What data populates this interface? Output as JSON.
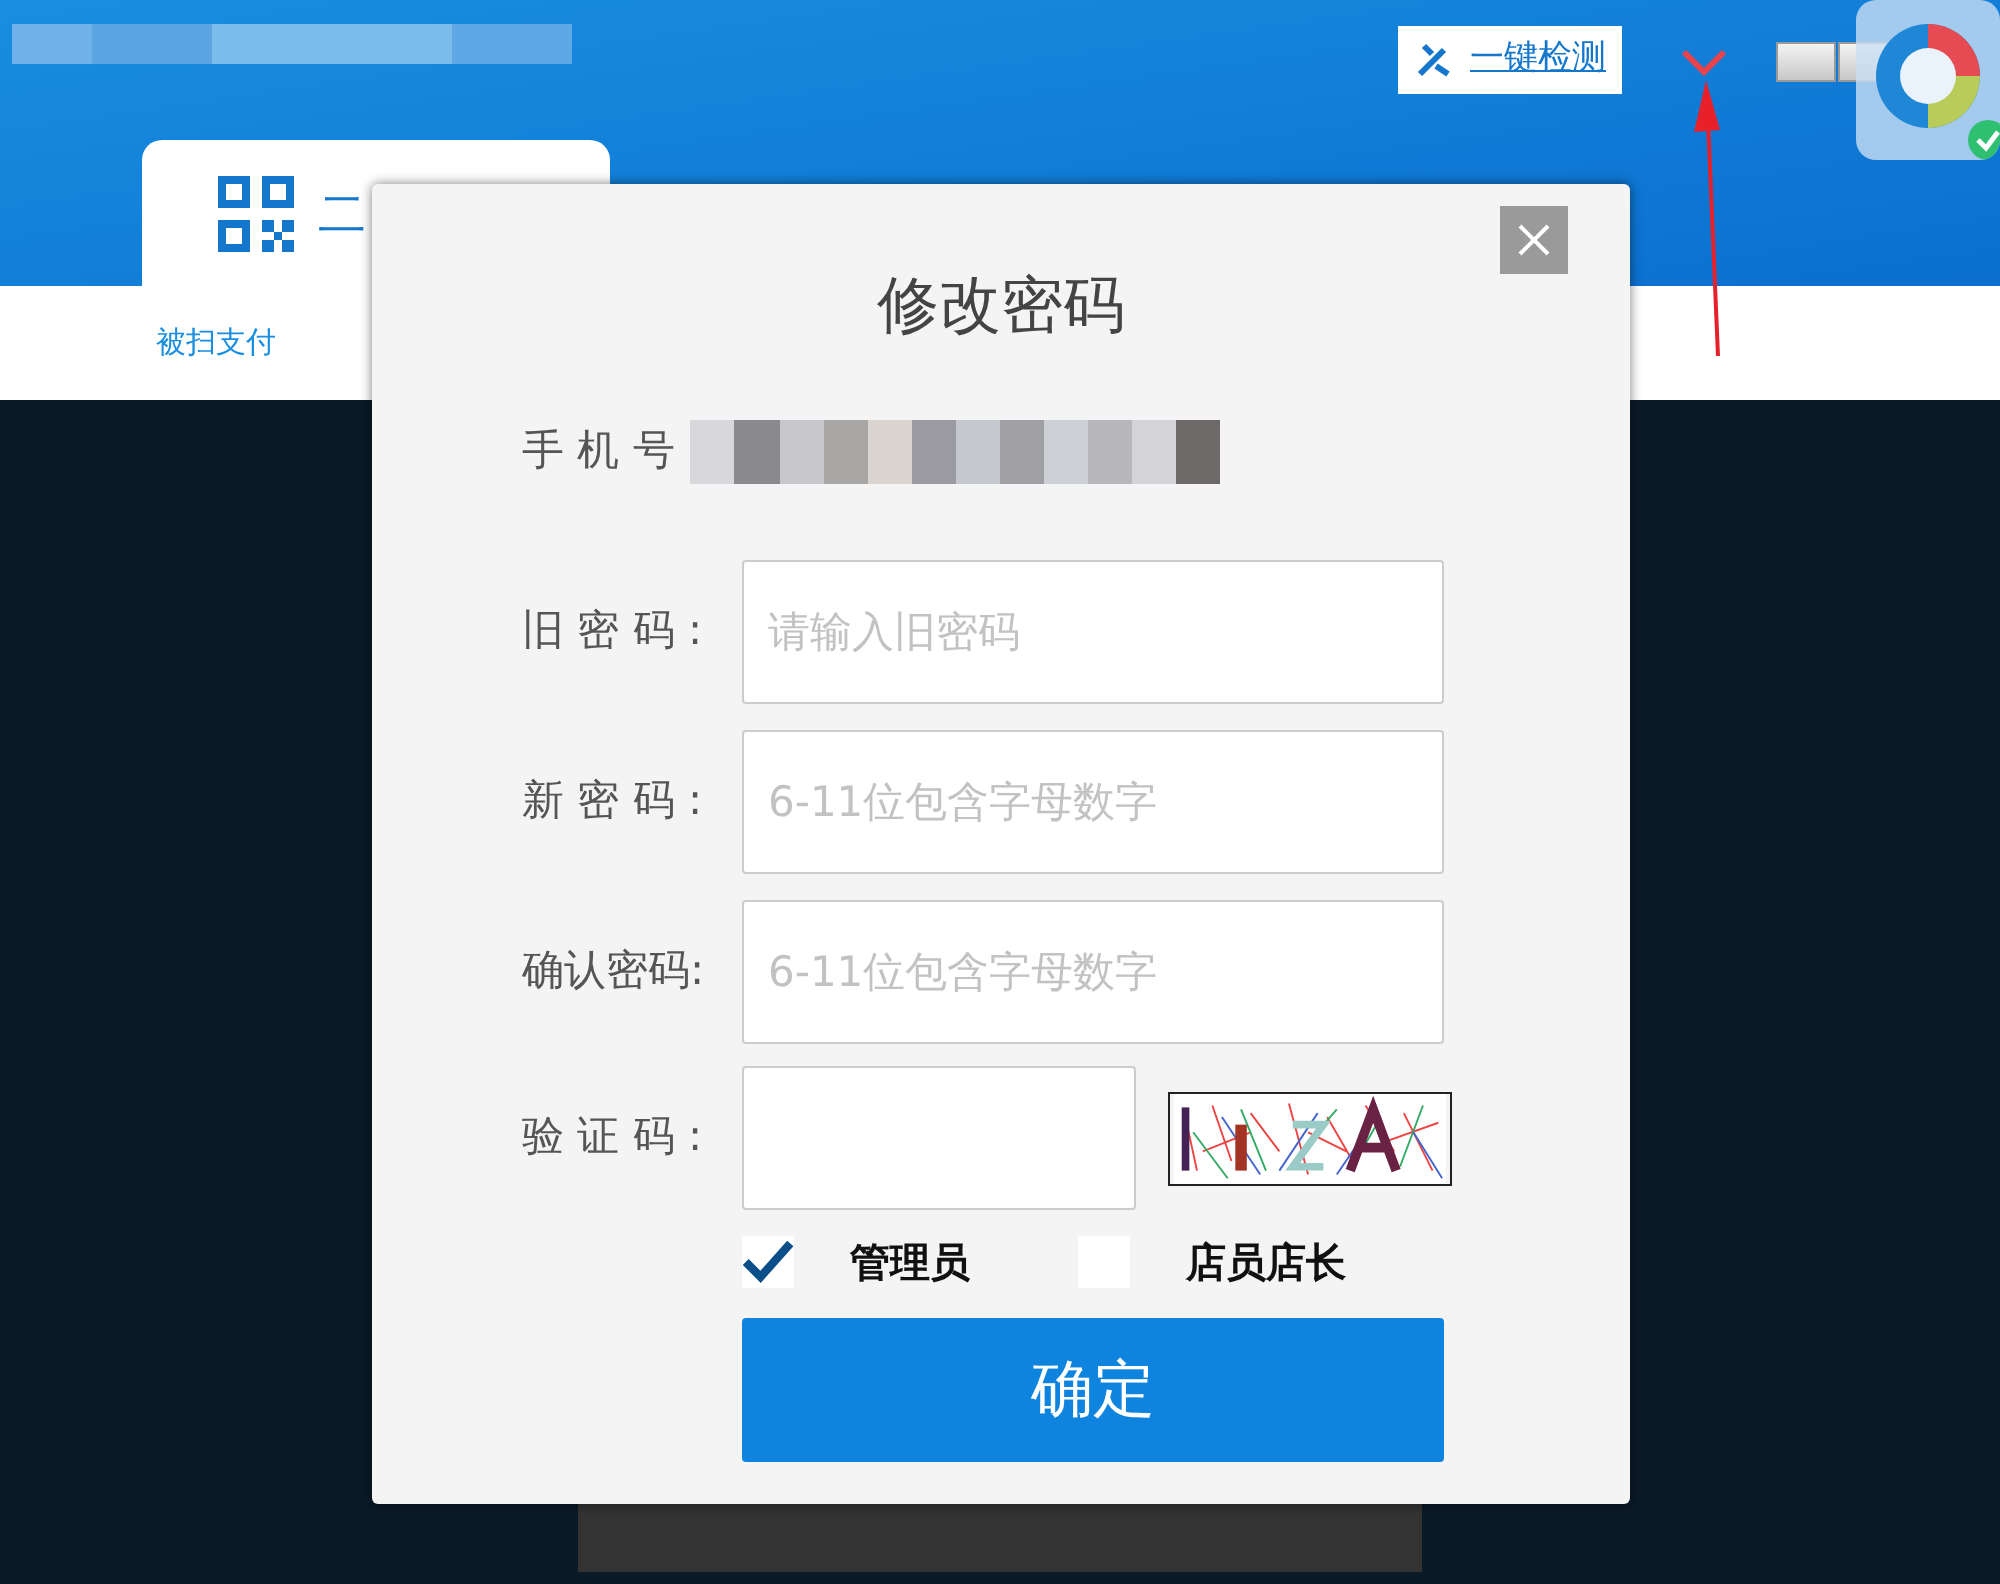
{
  "header": {
    "check_button": "一键检测"
  },
  "tabs": [
    {
      "label": "二",
      "selected": true
    }
  ],
  "subnav": [
    {
      "label": "被扫支付"
    }
  ],
  "dialog": {
    "title": "修改密码",
    "phone_label": "手 机 号",
    "fields": [
      {
        "label": "旧 密 码 :",
        "placeholder": "请输入旧密码"
      },
      {
        "label": "新 密 码 :",
        "placeholder": "6-11位包含字母数字"
      },
      {
        "label": "确认密码:",
        "placeholder": "6-11位包含字母数字"
      }
    ],
    "captcha_label": "验 证 码 :",
    "roles": [
      {
        "label": "管理员",
        "checked": true
      },
      {
        "label": "店员店长",
        "checked": false
      }
    ],
    "submit": "确定"
  }
}
